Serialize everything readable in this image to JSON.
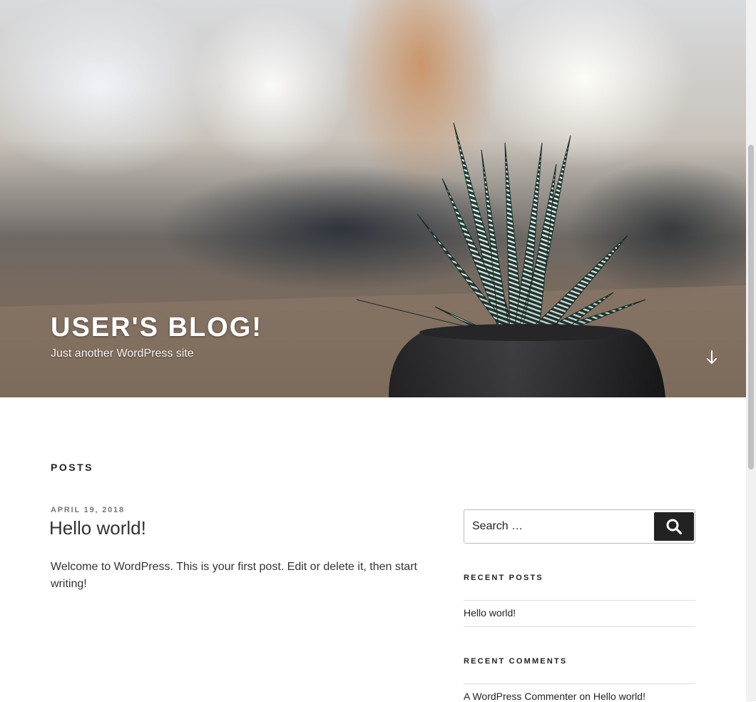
{
  "header": {
    "site_title": "USER'S BLOG!",
    "site_description": "Just another WordPress site",
    "scroll_icon": "arrow-down-icon"
  },
  "main": {
    "section_title": "POSTS",
    "posts": [
      {
        "date": "APRIL 19, 2018",
        "title": "Hello world!",
        "excerpt": "Welcome to WordPress. This is your first post. Edit or delete it, then start writing!"
      }
    ]
  },
  "sidebar": {
    "search": {
      "placeholder": "Search …",
      "button_icon": "search-icon"
    },
    "recent_posts": {
      "title": "RECENT POSTS",
      "items": [
        "Hello world!"
      ]
    },
    "recent_comments": {
      "title": "RECENT COMMENTS",
      "items": [
        {
          "author": "A WordPress Commenter",
          "connector": "on",
          "post": "Hello world!"
        }
      ]
    }
  },
  "colors": {
    "text": "#222222",
    "meta": "#767676",
    "button": "#222222"
  }
}
